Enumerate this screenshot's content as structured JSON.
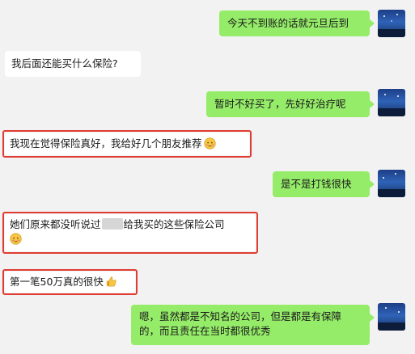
{
  "messages": {
    "m1": {
      "text": "今天不到账的话就元旦后到"
    },
    "m2": {
      "text": "我后面还能买什么保险?"
    },
    "m3": {
      "text": "暂时不好买了，先好好治疗呢"
    },
    "m4": {
      "text": "我现在觉得保险真好，我给好几个朋友推荐"
    },
    "m5": {
      "text": "是不是打钱很快"
    },
    "m6": {
      "text_before": "她们原来都没听说过",
      "text_after": "给我买的这些保险公司"
    },
    "m7": {
      "text": "第一笔50万真的很快"
    },
    "m8": {
      "line1": "嗯，虽然都是不知名的公司，但是都是有保障",
      "line2": "的，而且责任在当时都很优秀"
    }
  },
  "colors": {
    "my_bubble": "#95ec69",
    "their_bubble": "#ffffff",
    "highlight": "#e03c31",
    "background": "#f2f2f2"
  },
  "icons": {
    "emoji_a": "shy-face-emoji",
    "emoji_b": "shy-face-emoji",
    "emoji_c": "thumbs-up-emoji",
    "avatar": "night-sky-avatar"
  }
}
